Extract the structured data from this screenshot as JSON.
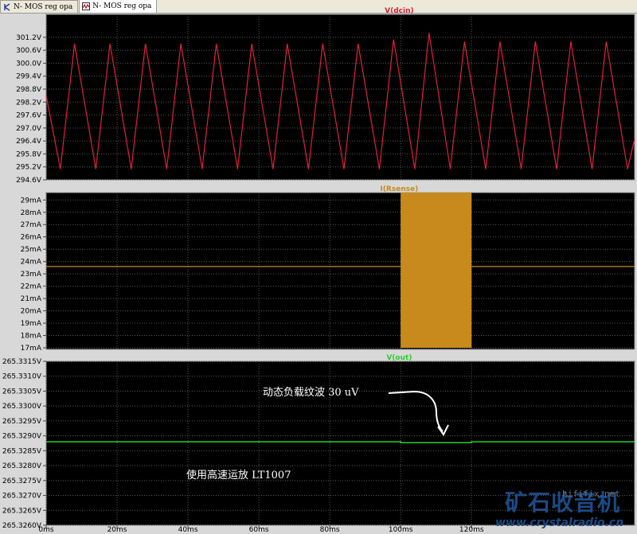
{
  "tabs": [
    {
      "label": "N- MOS reg opa",
      "icon": "schematic-icon",
      "active": false
    },
    {
      "label": "N- MOS reg opa",
      "icon": "waveform-icon",
      "active": true
    }
  ],
  "colors": {
    "plot_bg": "#000000",
    "panel_border": "#9a9a9a",
    "grid": "#5a5a5a",
    "label_text": "#c8c8c8",
    "dcin_trace": "#e0203a",
    "rsense_trace": "#c88a1c",
    "vout_trace": "#28d028",
    "annotation_text": "#ffffff"
  },
  "chart_data": [
    {
      "type": "line",
      "title": "V(dcin)",
      "ylim": [
        294.6,
        301.6
      ],
      "y_ticks": [
        "301.2V",
        "300.6V",
        "300.0V",
        "299.4V",
        "298.8V",
        "298.2V",
        "297.6V",
        "297.0V",
        "296.4V",
        "295.8V",
        "295.2V",
        "294.6V"
      ],
      "y_tick_values": [
        301.2,
        300.6,
        300.0,
        299.4,
        298.8,
        298.2,
        297.6,
        297.0,
        296.4,
        295.8,
        295.2,
        294.6
      ],
      "grid": true,
      "series": [
        {
          "x": [
            0,
            4,
            8,
            14,
            18,
            24,
            28,
            34,
            38,
            44,
            48,
            54,
            58,
            64,
            68,
            74,
            78,
            84,
            88,
            94,
            98,
            104,
            108,
            114,
            118,
            124,
            128,
            134,
            138,
            144,
            148,
            154,
            158,
            164,
            166
          ],
          "values": [
            298.5,
            295.1,
            300.9,
            295.1,
            300.9,
            295.1,
            300.9,
            295.1,
            300.9,
            295.1,
            300.9,
            295.1,
            300.9,
            295.1,
            300.9,
            295.1,
            300.9,
            295.1,
            300.9,
            295.1,
            301.1,
            295.1,
            301.4,
            295.1,
            301.0,
            295.1,
            301.0,
            295.1,
            301.0,
            295.1,
            301.0,
            295.1,
            301.0,
            295.1,
            296.5
          ]
        }
      ]
    },
    {
      "type": "line",
      "title": "I(Rsense)",
      "ylim": [
        17,
        29.6
      ],
      "y_ticks": [
        "29mA",
        "28mA",
        "27mA",
        "26mA",
        "25mA",
        "24mA",
        "23mA",
        "22mA",
        "21mA",
        "20mA",
        "19mA",
        "18mA",
        "17mA"
      ],
      "y_tick_values": [
        29,
        28,
        27,
        26,
        25,
        24,
        23,
        22,
        21,
        20,
        19,
        18,
        17
      ],
      "grid": true,
      "series": [
        {
          "x": [
            0,
            100,
            100,
            120,
            120,
            166
          ],
          "values": [
            23.6,
            23.6,
            29.6,
            17.0,
            23.6,
            23.6
          ]
        }
      ]
    },
    {
      "type": "line",
      "title": "V(out)",
      "ylim": [
        265.326,
        265.3315
      ],
      "y_ticks": [
        "265.3315V",
        "265.3310V",
        "265.3305V",
        "265.3300V",
        "265.3295V",
        "265.3290V",
        "265.3285V",
        "265.3280V",
        "265.3275V",
        "265.3270V",
        "265.3265V",
        "265.3260V"
      ],
      "y_tick_values": [
        265.3315,
        265.331,
        265.3305,
        265.33,
        265.3295,
        265.329,
        265.3285,
        265.328,
        265.3275,
        265.327,
        265.3265,
        265.326
      ],
      "grid": true,
      "x_ticks": [
        "0ms",
        "20ms",
        "40ms",
        "60ms",
        "80ms",
        "100ms",
        "120ms"
      ],
      "x_tick_values": [
        0,
        20,
        40,
        60,
        80,
        100,
        120
      ],
      "xlim": [
        0,
        166
      ],
      "series": [
        {
          "x": [
            0,
            100,
            100,
            120,
            120,
            166
          ],
          "values": [
            265.3288,
            265.3288,
            265.32877,
            265.32877,
            265.3288,
            265.3288
          ]
        }
      ],
      "annotations": [
        {
          "text": "动态负载纹波 30 uV"
        },
        {
          "text": "使用高速运放 LT1007"
        }
      ]
    }
  ],
  "watermark": {
    "site_cn": "矿石收音机",
    "site_url": "www.crystalradio.cn",
    "small": "hififix.net"
  }
}
